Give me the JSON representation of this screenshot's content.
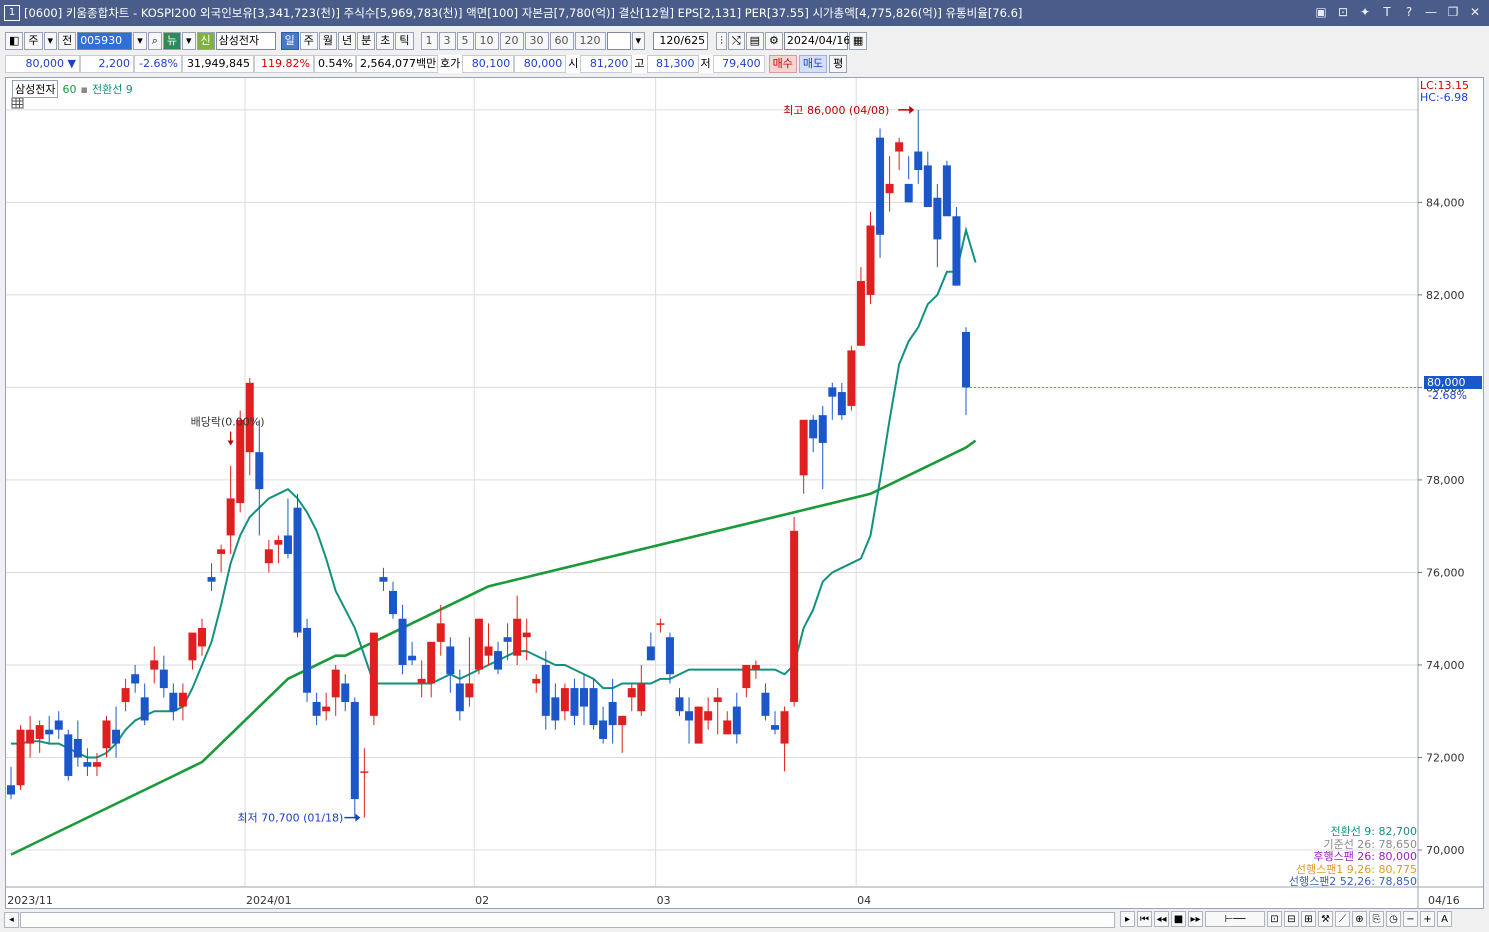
{
  "window": {
    "num": "1",
    "title": "[0600] 키움종합차트 - KOSPI200 외국인보유[3,341,723(천)] 주식수[5,969,783(천)] 액면[100] 자본금[7,780(억)] 결산[12월] EPS[2,131] PER[37.55] 시가총액[4,775,826(억)] 유통비율[76.6]"
  },
  "toolbar": {
    "market": "주",
    "prefix": "전",
    "code": "005930",
    "news": "뉴",
    "credit": "신",
    "name": "삼성전자",
    "periods": [
      "일",
      "주",
      "월",
      "년",
      "분",
      "초",
      "틱"
    ],
    "intervals": [
      "1",
      "3",
      "5",
      "10",
      "20",
      "30",
      "60",
      "120"
    ],
    "count": "120/625",
    "date": "2024/04/16"
  },
  "quote": {
    "price": "80,000",
    "arrow": "▼",
    "change": "2,200",
    "rate": "-2.68%",
    "volume": "31,949,845",
    "vol_ratio": "119.82%",
    "turnover": "0.54%",
    "amount": "2,564,077백만",
    "hoga_label": "호가",
    "ask": "80,100",
    "bid": "80,000",
    "open_label": "시",
    "open": "81,200",
    "high_label": "고",
    "high": "81,300",
    "low_label": "저",
    "low": "79,400",
    "buy_btn": "매수",
    "sell_btn": "매도",
    "eval_btn": "평"
  },
  "legend": {
    "stock": "삼성전자",
    "ma": "60",
    "line": "전환선 9"
  },
  "indicators": {
    "lc": "LC:13.15",
    "hc": "HC:-6.98",
    "cur_price": "80,000",
    "cur_rate": "-2.68%",
    "ichimoku": [
      {
        "label": "전환선 9: 82,700",
        "color": "#13917f"
      },
      {
        "label": "기준선 26: 78,650",
        "color": "#8a8a8a"
      },
      {
        "label": "후행스팬 26: 80,000",
        "color": "#9b1cc9"
      },
      {
        "label": "선행스팬1 9,26: 80,775",
        "color": "#e09a2a"
      },
      {
        "label": "선행스팬2 52,26: 78,850",
        "color": "#3a5fb8"
      }
    ]
  },
  "chart_data": {
    "type": "candlestick",
    "y_ticks": [
      70000,
      72000,
      74000,
      76000,
      78000,
      80000,
      82000,
      84000
    ],
    "y_tick_labels": [
      "70,000",
      "72,000",
      "74,000",
      "76,000",
      "78,000",
      "80,000",
      "82,000",
      "84,000"
    ],
    "ylim": [
      69200,
      86300
    ],
    "x_labels": [
      {
        "i": 0,
        "label": "2023/11"
      },
      {
        "i": 25,
        "label": "2024/01"
      },
      {
        "i": 49,
        "label": "02"
      },
      {
        "i": 68,
        "label": "03"
      },
      {
        "i": 89,
        "label": "04"
      }
    ],
    "right_date": "04/16",
    "annotations": {
      "high": "최고 86,000 (04/08)",
      "low": "최저 70,700 (01/18)",
      "dividend": "배당락(0.00%)"
    },
    "candles": [
      [
        71400,
        71800,
        71100,
        71200
      ],
      [
        71400,
        72700,
        71300,
        72600
      ],
      [
        72300,
        72900,
        72000,
        72600
      ],
      [
        72400,
        72800,
        72100,
        72700
      ],
      [
        72600,
        72900,
        72300,
        72500
      ],
      [
        72800,
        73000,
        72400,
        72600
      ],
      [
        72500,
        72600,
        71500,
        71600
      ],
      [
        72400,
        72800,
        71800,
        72000
      ],
      [
        71900,
        72200,
        71600,
        71800
      ],
      [
        71800,
        72100,
        71600,
        71900
      ],
      [
        72200,
        72900,
        72000,
        72800
      ],
      [
        72600,
        73100,
        72000,
        72300
      ],
      [
        73200,
        73700,
        73000,
        73500
      ],
      [
        73800,
        74000,
        73400,
        73600
      ],
      [
        73300,
        73600,
        72700,
        72800
      ],
      [
        73900,
        74400,
        73600,
        74100
      ],
      [
        73900,
        74200,
        73300,
        73500
      ],
      [
        73400,
        73600,
        72800,
        73000
      ],
      [
        73100,
        73600,
        72800,
        73400
      ],
      [
        74100,
        74600,
        73900,
        74700
      ],
      [
        74400,
        75000,
        74200,
        74800
      ],
      [
        75900,
        76200,
        75600,
        75800
      ],
      [
        76400,
        76600,
        76000,
        76500
      ],
      [
        76800,
        78300,
        76400,
        77600
      ],
      [
        77500,
        79500,
        77300,
        79300
      ],
      [
        78600,
        80200,
        78100,
        80100
      ],
      [
        78600,
        79300,
        76800,
        77800
      ],
      [
        76200,
        76700,
        76000,
        76500
      ],
      [
        76600,
        76800,
        76200,
        76700
      ],
      [
        76800,
        77600,
        76300,
        76400
      ],
      [
        77400,
        77700,
        74600,
        74700
      ],
      [
        74800,
        75000,
        73200,
        73400
      ],
      [
        73200,
        73400,
        72700,
        72900
      ],
      [
        73000,
        73400,
        72800,
        73100
      ],
      [
        73300,
        74000,
        72900,
        73900
      ],
      [
        73600,
        73800,
        73000,
        73200
      ],
      [
        73200,
        73300,
        70700,
        71100
      ],
      [
        71700,
        72200,
        70700,
        71700
      ],
      [
        72900,
        74600,
        72700,
        74700
      ],
      [
        75900,
        76100,
        75600,
        75800
      ],
      [
        75600,
        75800,
        75000,
        75100
      ],
      [
        75000,
        75300,
        73800,
        74000
      ],
      [
        74200,
        74500,
        74000,
        74100
      ],
      [
        73600,
        74100,
        73300,
        73700
      ],
      [
        73600,
        74300,
        73300,
        74500
      ],
      [
        74500,
        75300,
        74200,
        74900
      ],
      [
        74400,
        74600,
        73400,
        73800
      ],
      [
        73600,
        73900,
        72800,
        73000
      ],
      [
        73300,
        74600,
        73100,
        73600
      ],
      [
        73900,
        75000,
        73800,
        75000
      ],
      [
        74200,
        74900,
        74000,
        74400
      ],
      [
        74300,
        74500,
        73800,
        73900
      ],
      [
        74600,
        74900,
        74100,
        74500
      ],
      [
        74200,
        75500,
        74000,
        75000
      ],
      [
        74600,
        75000,
        74100,
        74700
      ],
      [
        73600,
        73800,
        73400,
        73700
      ],
      [
        74000,
        74300,
        72600,
        72900
      ],
      [
        73300,
        73600,
        72600,
        72800
      ],
      [
        73000,
        73600,
        72800,
        73500
      ],
      [
        73500,
        73700,
        72700,
        72900
      ],
      [
        73500,
        73800,
        72700,
        73100
      ],
      [
        73500,
        73700,
        72600,
        72700
      ],
      [
        72800,
        73100,
        72300,
        72400
      ],
      [
        73200,
        73700,
        72300,
        72700
      ],
      [
        72700,
        72900,
        72100,
        72900
      ],
      [
        73300,
        73600,
        73000,
        73500
      ],
      [
        73000,
        74000,
        72900,
        73600
      ],
      [
        74400,
        74700,
        74200,
        74100
      ],
      [
        74900,
        75000,
        74700,
        74900
      ],
      [
        74600,
        74700,
        73600,
        73800
      ],
      [
        73300,
        73500,
        72900,
        73000
      ],
      [
        73000,
        73300,
        72300,
        72800
      ],
      [
        72300,
        73100,
        72400,
        73100
      ],
      [
        72800,
        73300,
        72600,
        73000
      ],
      [
        73200,
        73500,
        72500,
        73300
      ],
      [
        72500,
        73000,
        72500,
        72800
      ],
      [
        73100,
        73400,
        72300,
        72500
      ],
      [
        73500,
        73900,
        73300,
        74000
      ],
      [
        73900,
        74100,
        73700,
        74000
      ],
      [
        73400,
        73600,
        72800,
        72900
      ],
      [
        72700,
        73000,
        72500,
        72600
      ],
      [
        72300,
        73100,
        71700,
        73000
      ],
      [
        73200,
        77200,
        73100,
        76900
      ],
      [
        78100,
        78400,
        77700,
        79300
      ],
      [
        79300,
        79400,
        78600,
        78900
      ],
      [
        79400,
        79600,
        77800,
        78800
      ],
      [
        80000,
        80100,
        79300,
        79800
      ],
      [
        79900,
        80100,
        79300,
        79400
      ],
      [
        79600,
        80900,
        79500,
        80800
      ],
      [
        80900,
        82600,
        80900,
        82300
      ],
      [
        82000,
        83800,
        81800,
        83500
      ],
      [
        85400,
        85600,
        82800,
        83300
      ],
      [
        84200,
        85000,
        83800,
        84400
      ],
      [
        85100,
        85400,
        84700,
        85300
      ],
      [
        84400,
        85000,
        84500,
        84000
      ],
      [
        85100,
        86000,
        84400,
        84700
      ],
      [
        84800,
        85100,
        83900,
        83900
      ],
      [
        84100,
        84400,
        82600,
        83200
      ],
      [
        84800,
        84900,
        83800,
        83700
      ],
      [
        83700,
        83900,
        82300,
        82200
      ],
      [
        81200,
        81300,
        79400,
        80000
      ]
    ],
    "ma60": [
      69900,
      70000,
      70100,
      70200,
      70300,
      70400,
      70500,
      70600,
      70700,
      70800,
      70900,
      71000,
      71100,
      71200,
      71300,
      71400,
      71500,
      71600,
      71700,
      71800,
      71900,
      72100,
      72300,
      72500,
      72700,
      72900,
      73100,
      73300,
      73500,
      73700,
      73800,
      73900,
      74000,
      74100,
      74200,
      74200,
      74300,
      74400,
      74500,
      74600,
      74700,
      74800,
      74900,
      75000,
      75100,
      75200,
      75300,
      75400,
      75500,
      75600,
      75700,
      75750,
      75800,
      75850,
      75900,
      75950,
      76000,
      76050,
      76100,
      76150,
      76200,
      76250,
      76300,
      76350,
      76400,
      76450,
      76500,
      76550,
      76600,
      76650,
      76700,
      76750,
      76800,
      76850,
      76900,
      76950,
      77000,
      77050,
      77100,
      77150,
      77200,
      77250,
      77300,
      77350,
      77400,
      77450,
      77500,
      77550,
      77600,
      77650,
      77700,
      77800,
      77900,
      78000,
      78100,
      78200,
      78300,
      78400,
      78500,
      78600,
      78700,
      78850
    ],
    "conv9": [
      72300,
      72300,
      72350,
      72350,
      72300,
      72300,
      72200,
      72100,
      72000,
      72000,
      72100,
      72300,
      72600,
      72800,
      72900,
      73000,
      73000,
      73000,
      73100,
      73500,
      74000,
      74500,
      75300,
      76200,
      76800,
      77200,
      77400,
      77600,
      77700,
      77800,
      77600,
      77300,
      76900,
      76300,
      75600,
      75200,
      74800,
      74200,
      73600,
      73600,
      73600,
      73600,
      73600,
      73600,
      73600,
      73700,
      73800,
      73700,
      73800,
      73900,
      74000,
      74100,
      74200,
      74300,
      74300,
      74200,
      74100,
      74000,
      74000,
      73900,
      73800,
      73700,
      73500,
      73500,
      73600,
      73600,
      73600,
      73600,
      73700,
      73700,
      73800,
      73900,
      73900,
      73900,
      73900,
      73900,
      73900,
      73900,
      73900,
      73900,
      73900,
      73800,
      74000,
      74800,
      75200,
      75800,
      76000,
      76100,
      76200,
      76300,
      76800,
      78000,
      79300,
      80500,
      81000,
      81300,
      81800,
      82000,
      82500,
      82500,
      83400,
      82700
    ]
  }
}
